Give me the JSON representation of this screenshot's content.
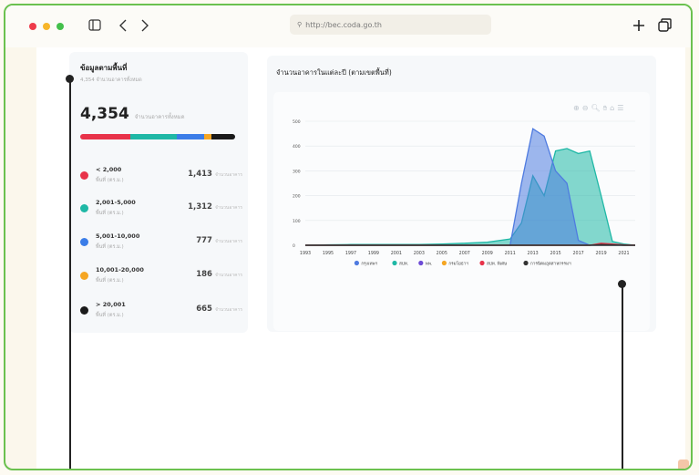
{
  "browser": {
    "url": "http://bec.coda.go.th"
  },
  "left_panel": {
    "title": "ข้อมูลตามพื้นที่",
    "subtitle": "4,354 จำนวนอาคารทั้งหมด",
    "total_value": "4,354",
    "total_label": "จำนวนอาคารทั้งหมด",
    "categories": [
      {
        "label": "< 2,000",
        "unit": "พื้นที่ (ตร.ม.)",
        "value": "1,413",
        "value_unit": "จำนวนอาคาร",
        "color": "#e8334a"
      },
      {
        "label": "2,001-5,000",
        "unit": "พื้นที่ (ตร.ม.)",
        "value": "1,312",
        "value_unit": "จำนวนอาคาร",
        "color": "#1fb8a6"
      },
      {
        "label": "5,001-10,000",
        "unit": "พื้นที่ (ตร.ม.)",
        "value": "777",
        "value_unit": "จำนวนอาคาร",
        "color": "#3b7de8"
      },
      {
        "label": "10,001-20,000",
        "unit": "พื้นที่ (ตร.ม.)",
        "value": "186",
        "value_unit": "จำนวนอาคาร",
        "color": "#f5a623"
      },
      {
        "label": "> 20,001",
        "unit": "พื้นที่ (ตร.ม.)",
        "value": "665",
        "value_unit": "จำนวนอาคาร",
        "color": "#1a1a1a"
      }
    ]
  },
  "chart_panel": {
    "title": "จำนวนอาคารในแต่ละปี (ตามเขตพื้นที่)"
  },
  "chart_data": {
    "type": "area",
    "x": [
      1993,
      1995,
      1997,
      1999,
      2001,
      2003,
      2005,
      2007,
      2009,
      2011,
      2012,
      2013,
      2014,
      2015,
      2016,
      2017,
      2018,
      2019,
      2020,
      2021,
      2022
    ],
    "xticks": [
      "1993",
      "1995",
      "1997",
      "1999",
      "2001",
      "2003",
      "2005",
      "2007",
      "2009",
      "2011",
      "2013",
      "2015",
      "2017",
      "2019",
      "2021"
    ],
    "ylim": [
      0,
      500
    ],
    "yticks": [
      "0",
      "100",
      "200",
      "300",
      "400",
      "500"
    ],
    "grid": true,
    "legend_position": "bottom",
    "series": [
      {
        "name": "กรุงเทพฯ",
        "color": "#4f7be0",
        "values": [
          0,
          0,
          0,
          0,
          0,
          0,
          0,
          0,
          0,
          0,
          250,
          470,
          440,
          300,
          250,
          20,
          0,
          0,
          0,
          0,
          0
        ]
      },
      {
        "name": "สปท.",
        "color": "#1fb8a6",
        "values": [
          0,
          2,
          3,
          3,
          3,
          3,
          5,
          8,
          12,
          25,
          90,
          280,
          200,
          380,
          390,
          370,
          380,
          200,
          15,
          5,
          0
        ]
      },
      {
        "name": "พพ.",
        "color": "#6d4bd6",
        "values": [
          0,
          0,
          0,
          0,
          0,
          0,
          0,
          0,
          0,
          0,
          0,
          0,
          0,
          0,
          0,
          0,
          0,
          2,
          2,
          0,
          0
        ]
      },
      {
        "name": "กรมโยธาฯ",
        "color": "#f5a623",
        "values": [
          0,
          0,
          0,
          0,
          0,
          0,
          0,
          0,
          0,
          0,
          0,
          0,
          0,
          0,
          0,
          0,
          0,
          3,
          2,
          0,
          0
        ]
      },
      {
        "name": "สปท. พิเศษ",
        "color": "#e8334a",
        "values": [
          0,
          0,
          0,
          0,
          0,
          0,
          0,
          0,
          0,
          0,
          0,
          0,
          0,
          0,
          0,
          0,
          0,
          8,
          5,
          2,
          0
        ]
      },
      {
        "name": "การนิคมอุตสาหกรรมฯ",
        "color": "#333333",
        "values": [
          0,
          0,
          0,
          0,
          0,
          0,
          0,
          0,
          0,
          0,
          0,
          0,
          0,
          0,
          0,
          0,
          0,
          3,
          2,
          0,
          0
        ]
      }
    ]
  }
}
